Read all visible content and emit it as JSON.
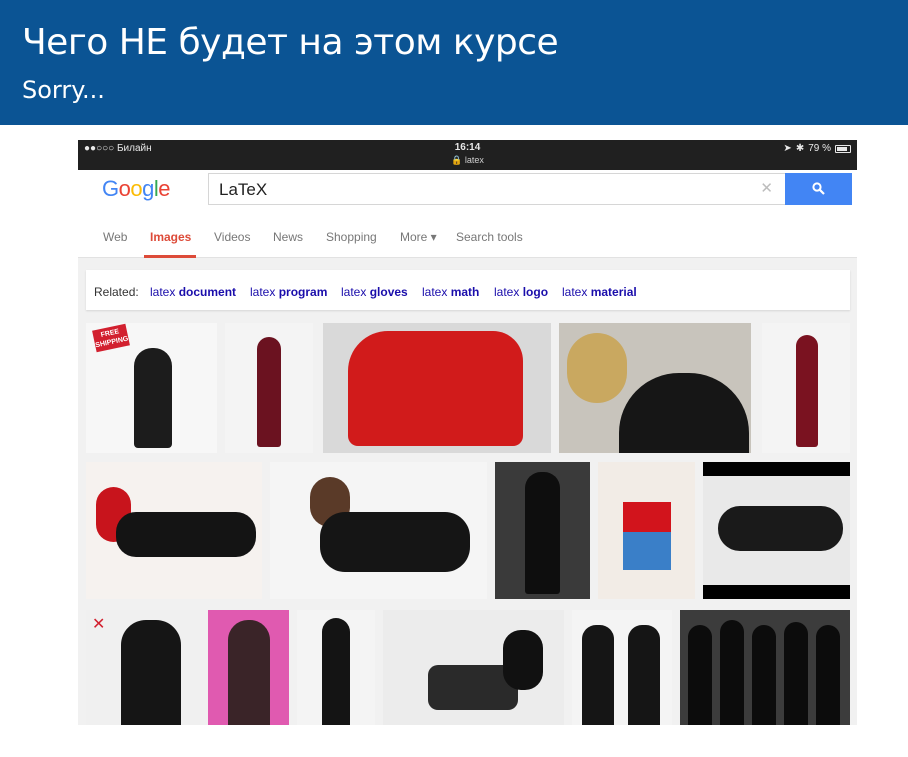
{
  "slide": {
    "title": "Чего НЕ будет на этом курсе",
    "subtitle": "Sorry..."
  },
  "status_bar": {
    "carrier": "●●○○○ Билайн",
    "time": "16:14",
    "url": "🔒 latex",
    "battery": "79 %"
  },
  "search": {
    "query": "LaTeX",
    "clear_glyph": "✕"
  },
  "tabs": [
    {
      "label": "Web",
      "active": false
    },
    {
      "label": "Images",
      "active": true
    },
    {
      "label": "Videos",
      "active": false
    },
    {
      "label": "News",
      "active": false
    },
    {
      "label": "Shopping",
      "active": false
    },
    {
      "label": "More ▾",
      "active": false
    },
    {
      "label": "Search tools",
      "active": false
    }
  ],
  "related": {
    "label": "Related:",
    "links": [
      {
        "prefix": "latex",
        "term": "document"
      },
      {
        "prefix": "latex",
        "term": "program"
      },
      {
        "prefix": "latex",
        "term": "gloves"
      },
      {
        "prefix": "latex",
        "term": "math"
      },
      {
        "prefix": "latex",
        "term": "logo"
      },
      {
        "prefix": "latex",
        "term": "material"
      }
    ]
  },
  "badges": {
    "free_shipping": "FREE SHIPPING"
  },
  "colors": {
    "slide_header": "#0b5494",
    "active_tab": "#dd4b39",
    "link": "#1a0dab",
    "search_button": "#4285f4"
  }
}
